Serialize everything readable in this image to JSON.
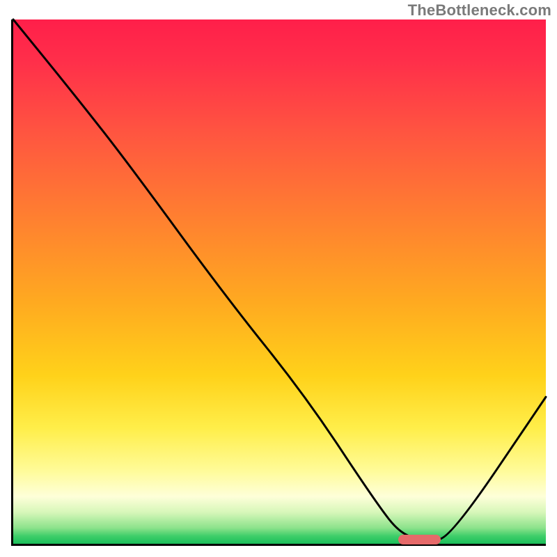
{
  "watermark": "TheBottleneck.com",
  "chart_data": {
    "type": "line",
    "title": "",
    "xlabel": "",
    "ylabel": "",
    "xlim": [
      0,
      100
    ],
    "ylim": [
      0,
      100
    ],
    "grid": false,
    "legend": false,
    "series": [
      {
        "name": "curve",
        "x": [
          0,
          12,
          22,
          40,
          55,
          68,
          73,
          78,
          82,
          100
        ],
        "y": [
          100,
          85,
          72,
          47,
          28,
          8,
          1.5,
          0.8,
          1.0,
          28
        ]
      }
    ],
    "marker": {
      "name": "highlight-segment",
      "x_start": 72,
      "x_end": 80,
      "y": 1.2,
      "color": "#e66a6a"
    },
    "background_gradient": {
      "stops": [
        {
          "pos": 0.0,
          "color": "#ff1f4a"
        },
        {
          "pos": 0.22,
          "color": "#ff5640"
        },
        {
          "pos": 0.54,
          "color": "#ffaa20"
        },
        {
          "pos": 0.78,
          "color": "#ffee4a"
        },
        {
          "pos": 0.91,
          "color": "#feffd9"
        },
        {
          "pos": 1.0,
          "color": "#1abf5a"
        }
      ]
    }
  }
}
